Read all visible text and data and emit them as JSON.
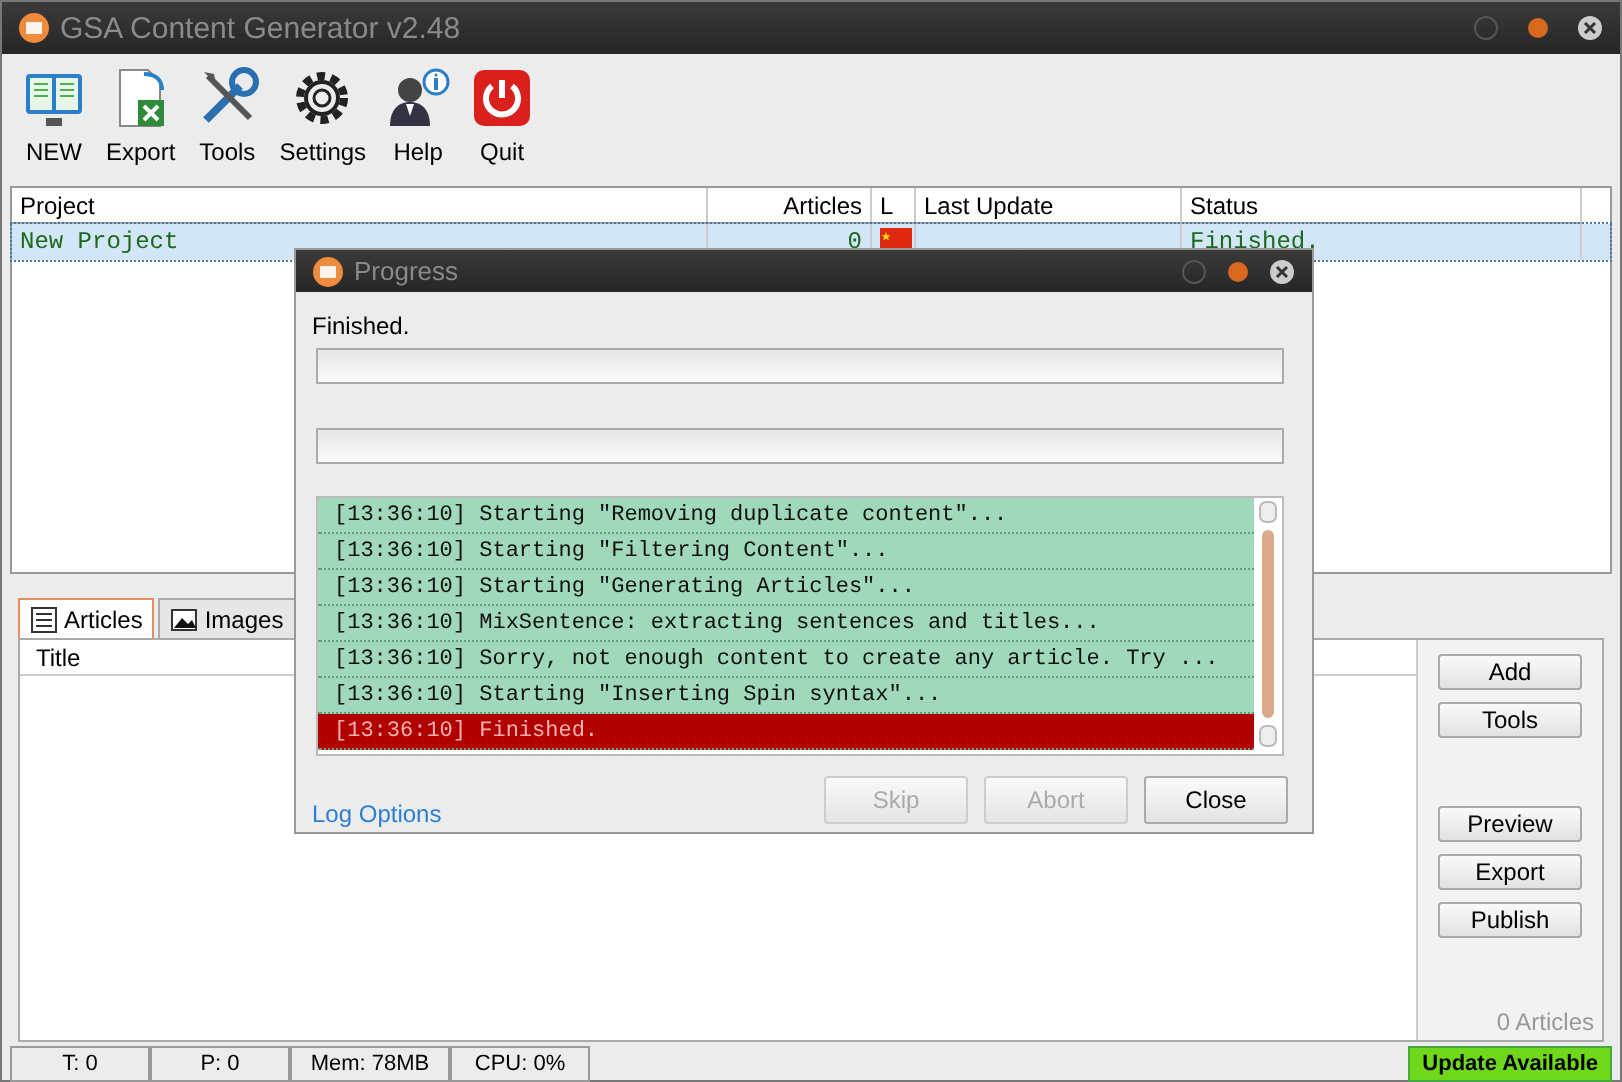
{
  "window": {
    "title": "GSA Content Generator v2.48"
  },
  "toolbar": [
    {
      "label": "NEW",
      "kind": "new"
    },
    {
      "label": "Export",
      "kind": "export"
    },
    {
      "label": "Tools",
      "kind": "tools"
    },
    {
      "label": "Settings",
      "kind": "settings"
    },
    {
      "label": "Help",
      "kind": "help"
    },
    {
      "label": "Quit",
      "kind": "quit"
    }
  ],
  "projects": {
    "columns": [
      "Project",
      "Articles",
      "L",
      "Last Update",
      "Status"
    ],
    "rows": [
      {
        "project": "New Project",
        "articles": "0",
        "status": "Finished.",
        "selected": true
      }
    ]
  },
  "tabs": [
    {
      "label": "Articles",
      "selected": true
    },
    {
      "label": "Images",
      "selected": false
    }
  ],
  "articles": {
    "columns": [
      "Title"
    ],
    "count": "0 Articles"
  },
  "side_buttons": [
    "Add",
    "Tools",
    "Preview",
    "Export",
    "Publish"
  ],
  "status_bar": {
    "items": [
      "T: 0",
      "P: 0",
      "Mem: 78MB",
      "CPU: 0%"
    ],
    "update": "Update Available"
  },
  "dialog": {
    "title": "Progress",
    "status": "Finished.",
    "bars": [
      {
        "level": 0
      },
      {
        "level": 0
      }
    ],
    "log": [
      {
        "text": "[13:36:10] Starting \"Removing duplicate content\"...",
        "kind": "info"
      },
      {
        "text": "[13:36:10] Starting \"Filtering Content\"...",
        "kind": "info"
      },
      {
        "text": "[13:36:10] Starting \"Generating Articles\"...",
        "kind": "info"
      },
      {
        "text": "[13:36:10] MixSentence: extracting sentences and titles...",
        "kind": "info"
      },
      {
        "text": "[13:36:10] Sorry, not enough content to create any article. Try ...",
        "kind": "info"
      },
      {
        "text": "[13:36:10] Starting \"Inserting Spin syntax\"...",
        "kind": "info"
      },
      {
        "text": "[13:36:10] Finished.",
        "kind": "error"
      }
    ],
    "link": "Log Options",
    "buttons": [
      {
        "label": "Skip",
        "disabled": true
      },
      {
        "label": "Abort",
        "disabled": true
      },
      {
        "label": "Close",
        "disabled": false
      }
    ]
  }
}
